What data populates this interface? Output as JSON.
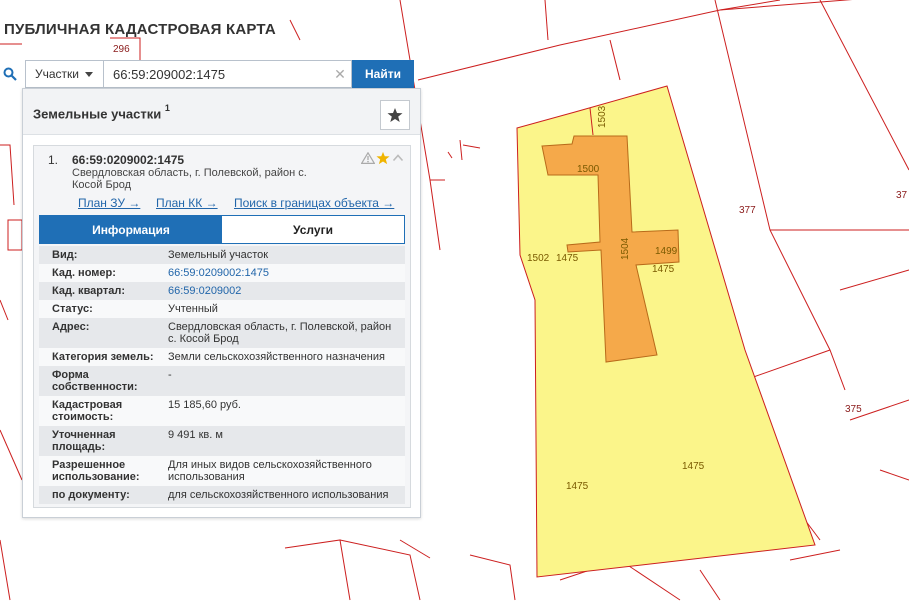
{
  "app": {
    "title": "ПУБЛИЧНАЯ КАДАСТРОВАЯ КАРТА"
  },
  "search": {
    "type_label": "Участки",
    "query": "66:59:209002:1475",
    "find_label": "Найти"
  },
  "panel": {
    "title": "Земельные участки",
    "count": "1"
  },
  "result": {
    "index": "1.",
    "number": "66:59:0209002:1475",
    "address": "Свердловская область, г. Полевской, район с. Косой Брод",
    "links": {
      "plan_zu": "План ЗУ →",
      "plan_kk": "План КК →",
      "search_bounds": "Поиск в границах объекта →"
    },
    "tabs": {
      "info": "Информация",
      "services": "Услуги"
    }
  },
  "info": [
    {
      "label": "Вид:",
      "value": "Земельный участок"
    },
    {
      "label": "Кад. номер:",
      "value": "66:59:0209002:1475"
    },
    {
      "label": "Кад. квартал:",
      "value": "66:59:0209002"
    },
    {
      "label": "Статус:",
      "value": "Учтенный"
    },
    {
      "label": "Адрес:",
      "value": "Свердловская область, г. Полевской, район с. Косой Брод"
    },
    {
      "label": "Категория земель:",
      "value": "Земли сельскохозяйственного назначения"
    },
    {
      "label": "Форма собственности:",
      "value": "-"
    },
    {
      "label": "Кадастровая стоимость:",
      "value": "15 185,60 руб."
    },
    {
      "label": "Уточненная площадь:",
      "value": "9 491 кв. м"
    },
    {
      "label": "Разрешенное использование:",
      "value": "Для иных видов сельскохозяйственного использования"
    },
    {
      "label": "по документу:",
      "value": "для сельскохозяйственного использования"
    }
  ],
  "map": {
    "labels": {
      "l296": "296",
      "l1503": "1503",
      "l1500": "1500",
      "l1502": "1502",
      "l1475a": "1475",
      "l1499": "1499",
      "l1475b": "1475",
      "l377": "377",
      "l37": "37",
      "l375": "375",
      "l1475c": "1475",
      "l1475d": "1475",
      "l1504": "1504"
    },
    "colors": {
      "parcel_fill": "#fbf58a",
      "building_fill": "#f5a94a",
      "boundary": "#cc1f1f"
    }
  },
  "icons": {
    "search": "search-icon",
    "star": "star-icon",
    "warning": "warning-icon",
    "collapse": "chevron-up-icon",
    "clear": "clear-icon"
  }
}
